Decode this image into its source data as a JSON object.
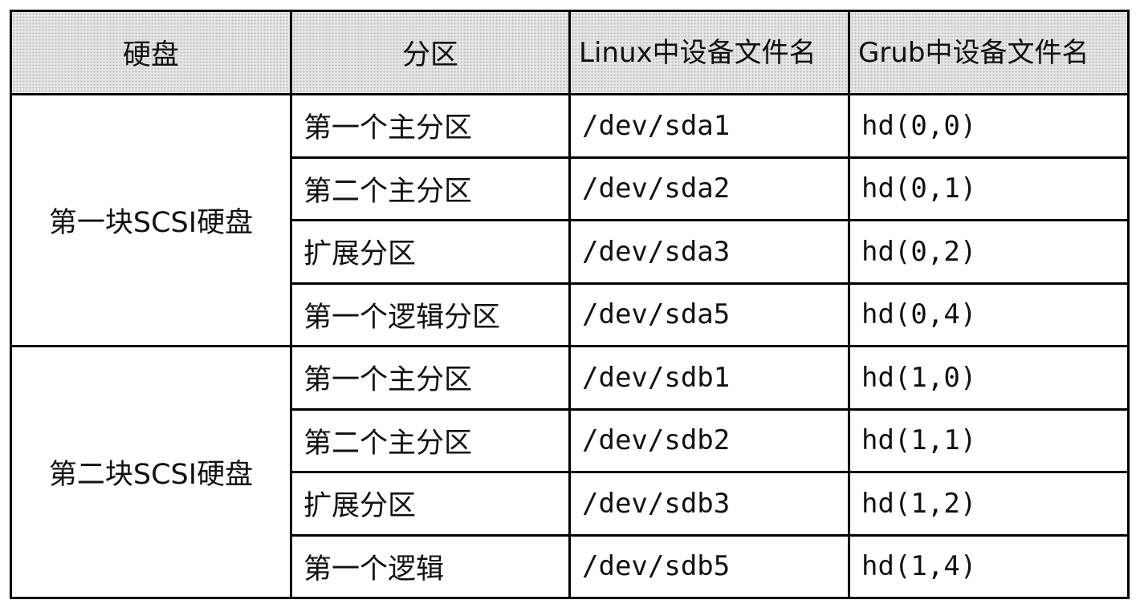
{
  "headers": {
    "disk": "硬盘",
    "partition": "分区",
    "linux_device": "Linux中设备文件名",
    "grub_device": "Grub中设备文件名"
  },
  "groups": [
    {
      "disk": "第一块SCSI硬盘",
      "rows": [
        {
          "partition": "第一个主分区",
          "linux": "/dev/sda1",
          "grub": "hd(0,0)"
        },
        {
          "partition": "第二个主分区",
          "linux": "/dev/sda2",
          "grub": "hd(0,1)"
        },
        {
          "partition": "扩展分区",
          "linux": "/dev/sda3",
          "grub": "hd(0,2)"
        },
        {
          "partition": "第一个逻辑分区",
          "linux": "/dev/sda5",
          "grub": "hd(0,4)"
        }
      ]
    },
    {
      "disk": "第二块SCSI硬盘",
      "rows": [
        {
          "partition": "第一个主分区",
          "linux": "/dev/sdb1",
          "grub": "hd(1,0)"
        },
        {
          "partition": "第二个主分区",
          "linux": "/dev/sdb2",
          "grub": "hd(1,1)"
        },
        {
          "partition": "扩展分区",
          "linux": "/dev/sdb3",
          "grub": "hd(1,2)"
        },
        {
          "partition": "第一个逻辑",
          "linux": "/dev/sdb5",
          "grub": "hd(1,4)"
        }
      ]
    }
  ]
}
